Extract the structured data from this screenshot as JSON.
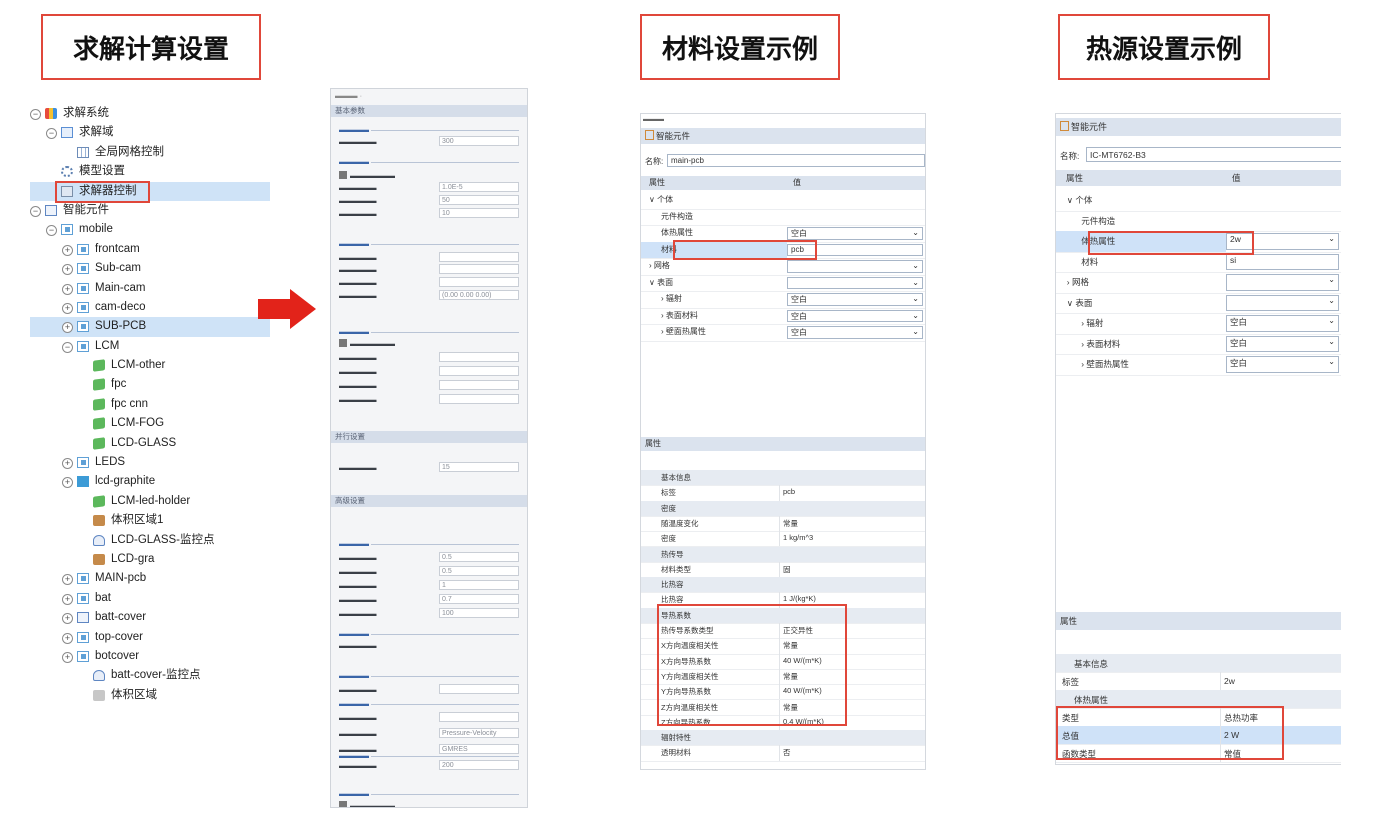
{
  "titles": {
    "solver": "求解计算设置",
    "material": "材料设置示例",
    "heat": "热源设置示例"
  },
  "tree": [
    {
      "label": "求解系统",
      "icon": "solver-system-icon"
    },
    {
      "label": "求解域",
      "icon": "domain-icon"
    },
    {
      "label": "全局网格控制",
      "icon": "grid-icon"
    },
    {
      "label": "模型设置",
      "icon": "gear-icon"
    },
    {
      "label": "求解器控制",
      "icon": "solver-control-icon"
    },
    {
      "label": "智能元件",
      "icon": "smart-part-icon"
    },
    {
      "label": "mobile",
      "icon": "assembly-icon"
    },
    {
      "label": "frontcam",
      "icon": "assembly-icon"
    },
    {
      "label": "Sub-cam",
      "icon": "assembly-icon"
    },
    {
      "label": "Main-cam",
      "icon": "assembly-icon"
    },
    {
      "label": "cam-deco",
      "icon": "assembly-icon"
    },
    {
      "label": "SUB-PCB",
      "icon": "assembly-icon"
    },
    {
      "label": "LCM",
      "icon": "assembly-icon"
    },
    {
      "label": "LCM-other",
      "icon": "cube-icon"
    },
    {
      "label": "fpc",
      "icon": "cube-icon"
    },
    {
      "label": "fpc cnn",
      "icon": "cube-icon"
    },
    {
      "label": "LCM-FOG",
      "icon": "cube-icon"
    },
    {
      "label": "LCD-GLASS",
      "icon": "cube-icon"
    },
    {
      "label": "LEDS",
      "icon": "assembly-icon"
    },
    {
      "label": "lcd-graphite",
      "icon": "pcb-icon"
    },
    {
      "label": "LCM-led-holder",
      "icon": "cube-icon"
    },
    {
      "label": "体积区域1",
      "icon": "volume-region-icon"
    },
    {
      "label": "LCD-GLASS-监控点",
      "icon": "probe-icon"
    },
    {
      "label": "LCD-gra",
      "icon": "volume-region-icon"
    },
    {
      "label": "MAIN-pcb",
      "icon": "assembly-icon"
    },
    {
      "label": "bat",
      "icon": "assembly-icon"
    },
    {
      "label": "batt-cover",
      "icon": "box-icon"
    },
    {
      "label": "top-cover",
      "icon": "assembly-icon"
    },
    {
      "label": "botcover",
      "icon": "assembly-icon"
    },
    {
      "label": "batt-cover-监控点",
      "icon": "probe-icon"
    },
    {
      "label": "体积区域",
      "icon": "volume-region-icon"
    }
  ],
  "solver_panel": {
    "sections": [
      "基本参数",
      "并行设置",
      "高级设置"
    ],
    "inputs": [
      "300",
      "1.0E-5",
      "50",
      "10",
      "0.5",
      "0.5",
      "1",
      "0.7",
      "100",
      "15",
      "200",
      "Pressure-Velocity",
      "GMRES",
      "(0.00 0.00 0.00)"
    ]
  },
  "material_panel": {
    "title": "智能元件",
    "name_label": "名称:",
    "name_value": "main-pcb",
    "col_property": "属性",
    "col_value": "值",
    "tree_rows": [
      {
        "label": "个体",
        "value": ""
      },
      {
        "label": "元件构造",
        "value": ""
      },
      {
        "label": "体热属性",
        "value": "空白"
      },
      {
        "label": "材料",
        "value": "pcb"
      },
      {
        "label": "网格",
        "value": ""
      },
      {
        "label": "表面",
        "value": ""
      },
      {
        "label": "辐射",
        "value": "空白"
      },
      {
        "label": "表面材料",
        "value": "空白"
      },
      {
        "label": "壁面热属性",
        "value": "空白"
      }
    ],
    "prop_header": "属性",
    "props": [
      {
        "label": "基本信息",
        "value": "",
        "group": true
      },
      {
        "label": "标签",
        "value": "pcb"
      },
      {
        "label": "密度",
        "value": "",
        "group": true
      },
      {
        "label": "随温度变化",
        "value": "常量"
      },
      {
        "label": "密度",
        "value": "1 kg/m^3"
      },
      {
        "label": "热传导",
        "value": "",
        "group": true
      },
      {
        "label": "材料类型",
        "value": "固"
      },
      {
        "label": "比热容",
        "value": "",
        "group": true
      },
      {
        "label": "比热容",
        "value": "1 J/(kg*K)"
      },
      {
        "label": "导热系数",
        "value": "",
        "group": true
      },
      {
        "label": "热传导系数类型",
        "value": "正交异性"
      },
      {
        "label": "X方向温度相关性",
        "value": "常量"
      },
      {
        "label": "X方向导热系数",
        "value": "40 W/(m*K)"
      },
      {
        "label": "Y方向温度相关性",
        "value": "常量"
      },
      {
        "label": "Y方向导热系数",
        "value": "40 W/(m*K)"
      },
      {
        "label": "Z方向温度相关性",
        "value": "常量"
      },
      {
        "label": "Z方向导热系数",
        "value": "0.4 W/(m*K)"
      },
      {
        "label": "辐射特性",
        "value": "",
        "group": true
      },
      {
        "label": "透明材料",
        "value": "否"
      }
    ]
  },
  "heat_panel": {
    "title": "智能元件",
    "name_label": "名称:",
    "name_value": "IC-MT6762-B3",
    "col_property": "属性",
    "col_value": "值",
    "tree_rows": [
      {
        "label": "个体",
        "value": ""
      },
      {
        "label": "元件构造",
        "value": ""
      },
      {
        "label": "体热属性",
        "value": "2w"
      },
      {
        "label": "材料",
        "value": "si"
      },
      {
        "label": "网格",
        "value": ""
      },
      {
        "label": "表面",
        "value": ""
      },
      {
        "label": "辐射",
        "value": "空白"
      },
      {
        "label": "表面材料",
        "value": "空白"
      },
      {
        "label": "壁面热属性",
        "value": "空白"
      }
    ],
    "prop_header": "属性",
    "props": [
      {
        "label": "基本信息",
        "value": "",
        "group": true
      },
      {
        "label": "标签",
        "value": "2w"
      },
      {
        "label": "体热属性",
        "value": "",
        "group": true
      },
      {
        "label": "类型",
        "value": "总热功率"
      },
      {
        "label": "总值",
        "value": "2 W"
      },
      {
        "label": "函数类型",
        "value": "常值"
      }
    ]
  },
  "colors": {
    "highlight": "#e0473a",
    "arrow": "#e2231a",
    "selection": "#cfe3f7",
    "section_bar": "#d5dde9"
  }
}
